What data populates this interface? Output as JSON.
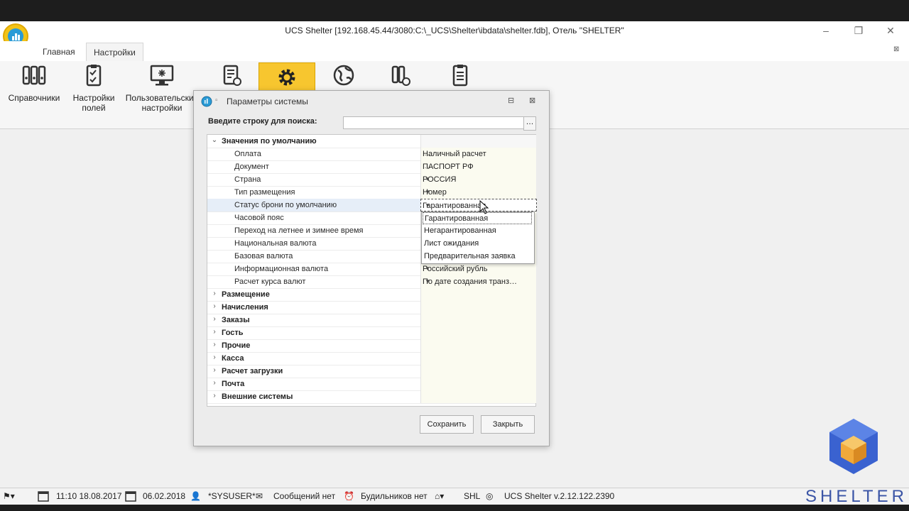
{
  "window": {
    "title": "UCS Shelter [192.168.45.44/3080:C:\\_UCS\\Shelter\\ibdata\\shelter.fdb], Отель \"SHELTER\""
  },
  "tabs": [
    {
      "label": "Главная"
    },
    {
      "label": "Настройки"
    }
  ],
  "ribbon": {
    "items": [
      {
        "label": "Справочники",
        "icon": "binders-icon"
      },
      {
        "label": "Настройки полей",
        "icon": "checklist-icon"
      },
      {
        "label": "Пользовательские настройки",
        "icon": "monitor-settings-icon"
      },
      {
        "label": "",
        "icon": "document-gear-icon"
      },
      {
        "label": "",
        "icon": "gear-icon"
      },
      {
        "label": "",
        "icon": "globe-icon"
      },
      {
        "label": "",
        "icon": "binders-clock-icon"
      },
      {
        "label": "",
        "icon": "clipboard-icon"
      }
    ]
  },
  "dialog": {
    "title": "Параметры системы",
    "search_label": "Введите строку для поиска:",
    "search_value": "",
    "group": "Значения по умолчанию",
    "rows": [
      {
        "name": "Оплата",
        "value": "Наличный расчет",
        "button": "…"
      },
      {
        "name": "Документ",
        "value": "ПАСПОРТ РФ",
        "button": "…"
      },
      {
        "name": "Страна",
        "value": "РОССИЯ",
        "button": "▾"
      },
      {
        "name": "Тип размещения",
        "value": "Номер",
        "button": "▾"
      },
      {
        "name": "Статус брони по умолчанию",
        "value": "Гарантированная",
        "button": "▾"
      },
      {
        "name": "Часовой пояс",
        "value": "",
        "button": ""
      },
      {
        "name": "Переход на летнее и зимнее время",
        "value": "",
        "button": ""
      },
      {
        "name": "Национальная валюта",
        "value": "",
        "button": ""
      },
      {
        "name": "Базовая валюта",
        "value": "",
        "button": ""
      },
      {
        "name": "Информационная валюта",
        "value": "Российский рубль",
        "button": "▾"
      },
      {
        "name": "Расчет курса валют",
        "value": "По дате создания транзакции",
        "button": "▾"
      }
    ],
    "categories": [
      {
        "name": "Размещение"
      },
      {
        "name": "Начисления"
      },
      {
        "name": "Заказы"
      },
      {
        "name": "Гость"
      },
      {
        "name": "Прочие"
      },
      {
        "name": "Касса"
      },
      {
        "name": "Расчет загрузки"
      },
      {
        "name": "Почта"
      },
      {
        "name": "Внешние системы"
      }
    ],
    "dropdown_options": [
      "Гарантированная",
      "Негарантированная",
      "Лист ожидания",
      "Предварительная заявка"
    ],
    "save_label": "Сохранить",
    "close_label": "Закрыть"
  },
  "statusbar": {
    "datetime": "11:10 18.08.2017",
    "date": "06.02.2018",
    "user": "*SYSUSER*",
    "messages": "Сообщений нет",
    "alarms": "Будильников нет",
    "hotel": "SHL",
    "version": "UCS Shelter v.2.12.122.2390"
  },
  "brand": {
    "name": "SHELTER"
  },
  "colors": {
    "accent": "#f7c62f",
    "brand": "#3b55a6"
  }
}
